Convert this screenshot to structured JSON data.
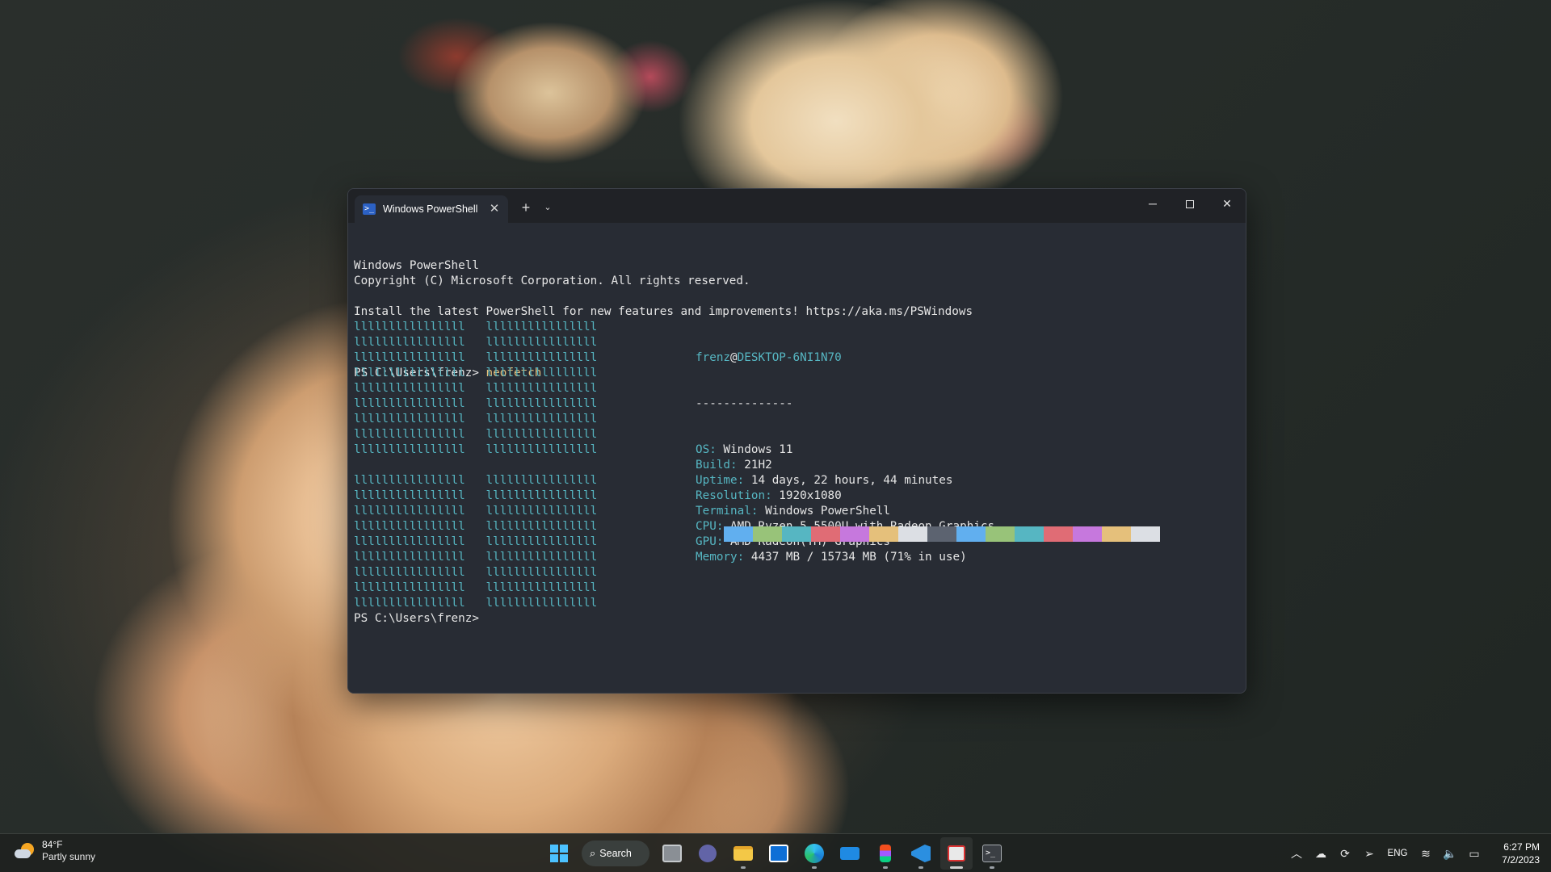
{
  "window": {
    "tab_title": "Windows PowerShell",
    "tab_icon_glyph": ">_",
    "new_tab_glyph": "+",
    "dropdown_glyph": "⌄",
    "close_tab_glyph": "✕",
    "minimize_glyph": "─",
    "close_glyph": "✕"
  },
  "terminal": {
    "banner": [
      "Windows PowerShell",
      "Copyright (C) Microsoft Corporation. All rights reserved.",
      "",
      "Install the latest PowerShell for new features and improvements! https://aka.ms/PSWindows",
      ""
    ],
    "prompt": "PS C:\\Users\\frenz> ",
    "command": "neofetch",
    "logo_rows": [
      "llllllllllllllll   llllllllllllllll",
      "llllllllllllllll   llllllllllllllll",
      "llllllllllllllll   llllllllllllllll",
      "llllllllllllllll   llllllllllllllll",
      "llllllllllllllll   llllllllllllllll",
      "llllllllllllllll   llllllllllllllll",
      "llllllllllllllll   llllllllllllllll",
      "llllllllllllllll   llllllllllllllll",
      "llllllllllllllll   llllllllllllllll",
      "",
      "llllllllllllllll   llllllllllllllll",
      "llllllllllllllll   llllllllllllllll",
      "llllllllllllllll   llllllllllllllll",
      "llllllllllllllll   llllllllllllllll",
      "llllllllllllllll   llllllllllllllll",
      "llllllllllllllll   llllllllllllllll",
      "llllllllllllllll   llllllllllllllll",
      "llllllllllllllll   llllllllllllllll",
      "llllllllllllllll   llllllllllllllll"
    ],
    "user": "frenz",
    "at": "@",
    "host": "DESKTOP-6NI1N70",
    "separator": "--------------",
    "info": [
      {
        "key": "OS:",
        "value": " Windows 11"
      },
      {
        "key": "Build:",
        "value": " 21H2"
      },
      {
        "key": "Uptime:",
        "value": " 14 days, 22 hours, 44 minutes"
      },
      {
        "key": "Resolution:",
        "value": " 1920x1080"
      },
      {
        "key": "Terminal:",
        "value": " Windows PowerShell"
      },
      {
        "key": "CPU:",
        "value": " AMD Ryzen 5 5500U with Radeon Graphics"
      },
      {
        "key": "GPU:",
        "value": " AMD Radeon(TM) Graphics"
      },
      {
        "key": "Memory:",
        "value": " 4437 MB / 15734 MB (71% in use)"
      }
    ],
    "palette": [
      "#61afef",
      "#98c379",
      "#56b6c2",
      "#e06c75",
      "#c678dd",
      "#e5c07b",
      "#dcdfe4",
      "#5c6370",
      "#61afef",
      "#98c379",
      "#56b6c2",
      "#e06c75",
      "#c678dd",
      "#e5c07b",
      "#dcdfe4"
    ],
    "final_prompt": "PS C:\\Users\\frenz>"
  },
  "taskbar": {
    "weather_temp": "84°F",
    "weather_desc": "Partly sunny",
    "search_label": "Search",
    "search_glyph": "⌕",
    "apps": [
      {
        "name": "task-view-icon"
      },
      {
        "name": "teams-chat-icon"
      },
      {
        "name": "file-explorer-icon"
      },
      {
        "name": "microsoft-store-icon"
      },
      {
        "name": "edge-browser-icon"
      },
      {
        "name": "mail-icon"
      },
      {
        "name": "figma-icon"
      },
      {
        "name": "vscode-icon"
      },
      {
        "name": "snipping-tool-icon"
      },
      {
        "name": "terminal-icon"
      }
    ],
    "tray": {
      "chevron": "︿",
      "onedrive_glyph": "☁",
      "sync_glyph": "⟳",
      "location_glyph": "➢",
      "language": "ENG",
      "wifi_glyph": "≋",
      "volume_glyph": "🔈",
      "battery_glyph": "▭",
      "time": "6:27 PM",
      "date": "7/2/2023"
    }
  },
  "colors": {
    "terminal_bg": "#282c34",
    "cyan": "#56b6c2",
    "command_yellow": "#e5c07b",
    "start_blue": "#4cc2ff"
  }
}
